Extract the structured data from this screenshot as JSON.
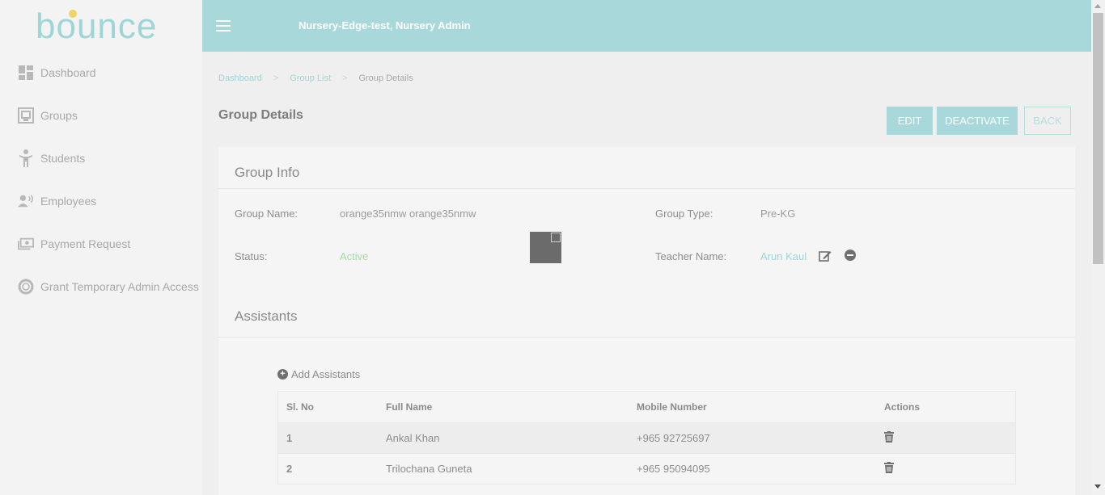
{
  "brand": {
    "logo_text": "bounce"
  },
  "header": {
    "title": "Nursery-Edge-test, Nursery Admin"
  },
  "sidebar": {
    "items": [
      {
        "label": "Dashboard",
        "icon": "dashboard-icon"
      },
      {
        "label": "Groups",
        "icon": "groups-icon"
      },
      {
        "label": "Students",
        "icon": "student-icon"
      },
      {
        "label": "Employees",
        "icon": "employees-icon"
      },
      {
        "label": "Payment Request",
        "icon": "money-icon"
      },
      {
        "label": "Grant Temporary Admin Access",
        "icon": "lifebuoy-icon"
      }
    ]
  },
  "breadcrumb": {
    "items": [
      "Dashboard",
      "Group List",
      "Group Details"
    ],
    "separator": ">"
  },
  "page": {
    "title": "Group Details"
  },
  "actions": {
    "edit": "EDIT",
    "deactivate": "DEACTIVATE",
    "back": "BACK"
  },
  "group_info": {
    "section_title": "Group Info",
    "group_name_label": "Group Name:",
    "group_name": "orange35nmw orange35nmw",
    "group_type_label": "Group Type:",
    "group_type": "Pre-KG",
    "status_label": "Status:",
    "status": "Active",
    "teacher_label": "Teacher Name:",
    "teacher": "Arun Kaul"
  },
  "assistants": {
    "section_title": "Assistants",
    "add_label": "Add Assistants",
    "columns": [
      "Sl. No",
      "Full Name",
      "Mobile Number",
      "Actions"
    ],
    "rows": [
      {
        "no": "1",
        "name": "Ankal Khan",
        "mobile": "+965 92725697"
      },
      {
        "no": "2",
        "name": "Trilochana Guneta",
        "mobile": "+965 95094095"
      }
    ]
  },
  "colors": {
    "accent": "#a8d8da",
    "link": "#9ed6d8",
    "active": "#a5d9a5",
    "logo_dot": "#f0d466"
  }
}
